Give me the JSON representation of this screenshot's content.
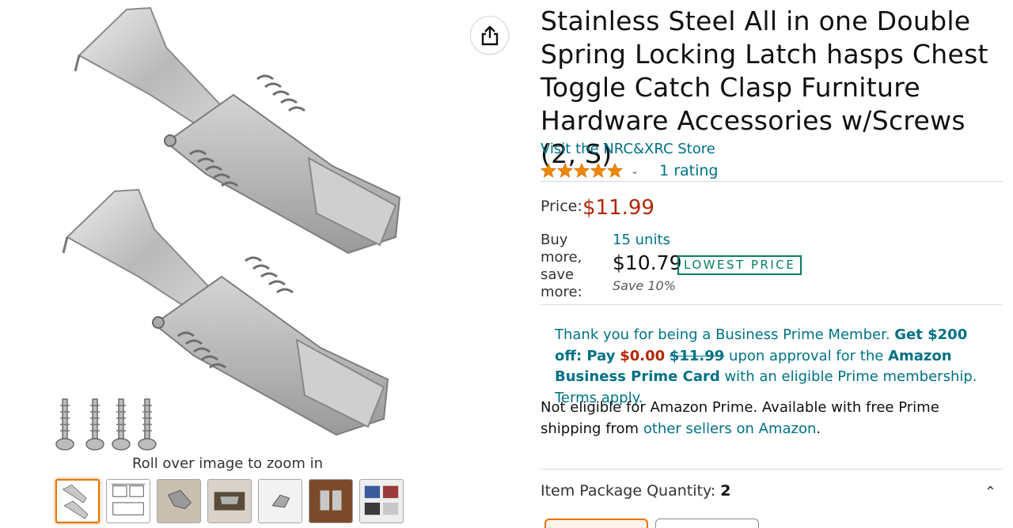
{
  "product": {
    "title": "Stainless Steel All in one Double Spring Locking Latch hasps Chest Toggle Catch Clasp Furniture Hardware Accessories w/Screws (2, S)",
    "store_link": "Visit the NRC&XRC Store",
    "rating_count": "1 rating",
    "stars": 5
  },
  "gallery": {
    "zoom_hint": "Roll over image to zoom in",
    "thumbnail_count": 7,
    "selected_thumbnail": 0
  },
  "price": {
    "label": "Price:",
    "value": "$11.99"
  },
  "bulk": {
    "label": "Buy more, save more:",
    "units": "15 units",
    "price": "$10.79",
    "badge": "LOWEST PRICE",
    "save": "Save 10%"
  },
  "promo": {
    "intro": "Thank you for being a Business Prime Member. ",
    "offer": "Get $200 off: Pay",
    "pay_amount": "$0.00",
    "strike_price": "$11.99",
    "mid": " upon approval for the ",
    "card_name": "Amazon Business Prime Card",
    "outro": " with an eligible Prime membership. Terms apply."
  },
  "shipping": {
    "text": "Not eligible for Amazon Prime. Available with free Prime shipping from ",
    "link": "other sellers on Amazon",
    "end": "."
  },
  "quantity": {
    "label": "Item Package Quantity: ",
    "value": "2"
  },
  "colors": {
    "link": "#007185",
    "price_red": "#b12704",
    "badge_green": "#067d62",
    "star_orange": "#f08804",
    "selected_orange": "#e77600"
  }
}
